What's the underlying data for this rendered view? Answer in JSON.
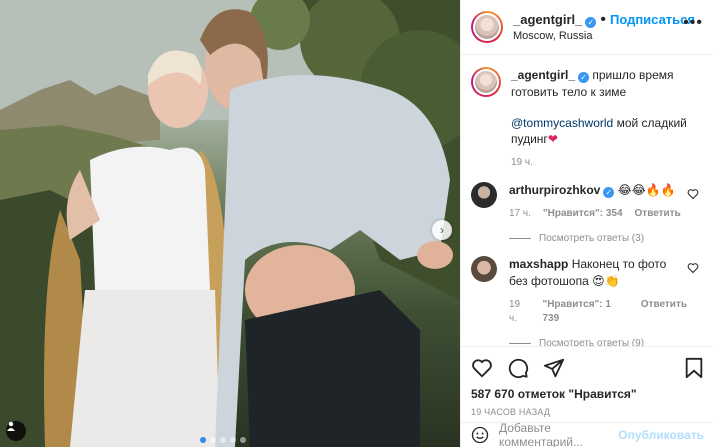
{
  "post": {
    "username": "_agentgirl_",
    "separator": "•",
    "follow_label": "Подписаться",
    "location": "Moscow, Russia",
    "more_icon": "more-dots-icon"
  },
  "caption": {
    "username": "_agentgirl_",
    "text_line1": "пришло время",
    "text_line2": "готовить тело к зиме",
    "mention": "@tommycashworld",
    "mention_text": "мой сладкий",
    "mention_text2": "пудинг",
    "heart_emoji": "❤",
    "time": "19 ч."
  },
  "comments": [
    {
      "username": "arthurpirozhkov",
      "verified": true,
      "text": "😂😂🔥🔥",
      "time": "17 ч.",
      "likes": "\"Нравится\": 354",
      "reply_label": "Ответить",
      "replies_label": "Посмотреть ответы (3)"
    },
    {
      "username": "maxshapp",
      "verified": false,
      "text": "Наконец то фото без фотошопа 😍👏",
      "time": "19 ч.",
      "likes": "\"Нравится\": 1 739",
      "reply_label": "Ответить",
      "replies_label": "Посмотреть ответы (9)"
    }
  ],
  "actions": {
    "likes_count": "587 670 отметок \"Нравится\"",
    "time_ago": "19 ЧАСОВ НАЗАД"
  },
  "add_comment": {
    "placeholder": "Добавьте комментарий...",
    "publish_label": "Опубликовать"
  },
  "colors": {
    "accent": "#0095f6",
    "verified": "#3897f0",
    "muted": "#8e8e8e"
  }
}
